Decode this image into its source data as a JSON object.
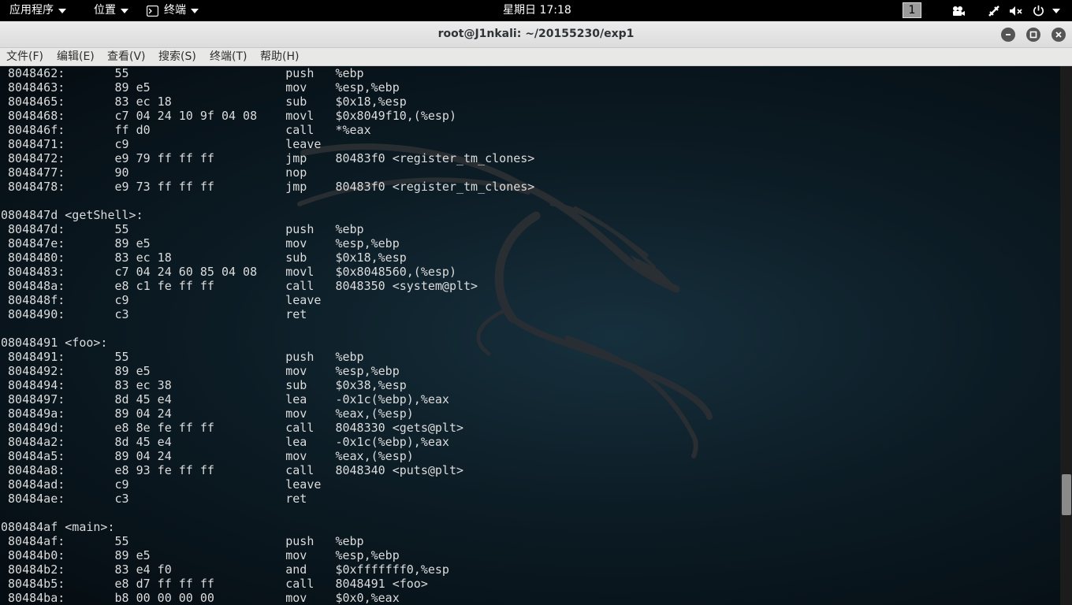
{
  "topbar": {
    "apps_label": "应用程序",
    "places_label": "位置",
    "terminal_label": "终端",
    "clock": "星期日 17:18",
    "workspace": "1"
  },
  "window": {
    "title": "root@J1nkali: ~/20155230/exp1"
  },
  "menubar": {
    "file": "文件(F)",
    "edit": "编辑(E)",
    "view": "查看(V)",
    "search": "搜索(S)",
    "terminal": "终端(T)",
    "help": "帮助(H)"
  },
  "terminal": {
    "lines": [
      " 8048462:\t55                   \tpush   %ebp",
      " 8048463:\t89 e5                \tmov    %esp,%ebp",
      " 8048465:\t83 ec 18             \tsub    $0x18,%esp",
      " 8048468:\tc7 04 24 10 9f 04 08 \tmovl   $0x8049f10,(%esp)",
      " 804846f:\tff d0                \tcall   *%eax",
      " 8048471:\tc9                   \tleave  ",
      " 8048472:\te9 79 ff ff ff       \tjmp    80483f0 <register_tm_clones>",
      " 8048477:\t90                   \tnop",
      " 8048478:\te9 73 ff ff ff       \tjmp    80483f0 <register_tm_clones>",
      "",
      "0804847d <getShell>:",
      " 804847d:\t55                   \tpush   %ebp",
      " 804847e:\t89 e5                \tmov    %esp,%ebp",
      " 8048480:\t83 ec 18             \tsub    $0x18,%esp",
      " 8048483:\tc7 04 24 60 85 04 08 \tmovl   $0x8048560,(%esp)",
      " 804848a:\te8 c1 fe ff ff       \tcall   8048350 <system@plt>",
      " 804848f:\tc9                   \tleave  ",
      " 8048490:\tc3                   \tret    ",
      "",
      "08048491 <foo>:",
      " 8048491:\t55                   \tpush   %ebp",
      " 8048492:\t89 e5                \tmov    %esp,%ebp",
      " 8048494:\t83 ec 38             \tsub    $0x38,%esp",
      " 8048497:\t8d 45 e4             \tlea    -0x1c(%ebp),%eax",
      " 804849a:\t89 04 24             \tmov    %eax,(%esp)",
      " 804849d:\te8 8e fe ff ff       \tcall   8048330 <gets@plt>",
      " 80484a2:\t8d 45 e4             \tlea    -0x1c(%ebp),%eax",
      " 80484a5:\t89 04 24             \tmov    %eax,(%esp)",
      " 80484a8:\te8 93 fe ff ff       \tcall   8048340 <puts@plt>",
      " 80484ad:\tc9                   \tleave  ",
      " 80484ae:\tc3                   \tret    ",
      "",
      "080484af <main>:",
      " 80484af:\t55                   \tpush   %ebp",
      " 80484b0:\t89 e5                \tmov    %esp,%ebp",
      " 80484b2:\t83 e4 f0             \tand    $0xfffffff0,%esp",
      " 80484b5:\te8 d7 ff ff ff       \tcall   8048491 <foo>",
      " 80484ba:\tb8 00 00 00 00       \tmov    $0x0,%eax"
    ]
  }
}
